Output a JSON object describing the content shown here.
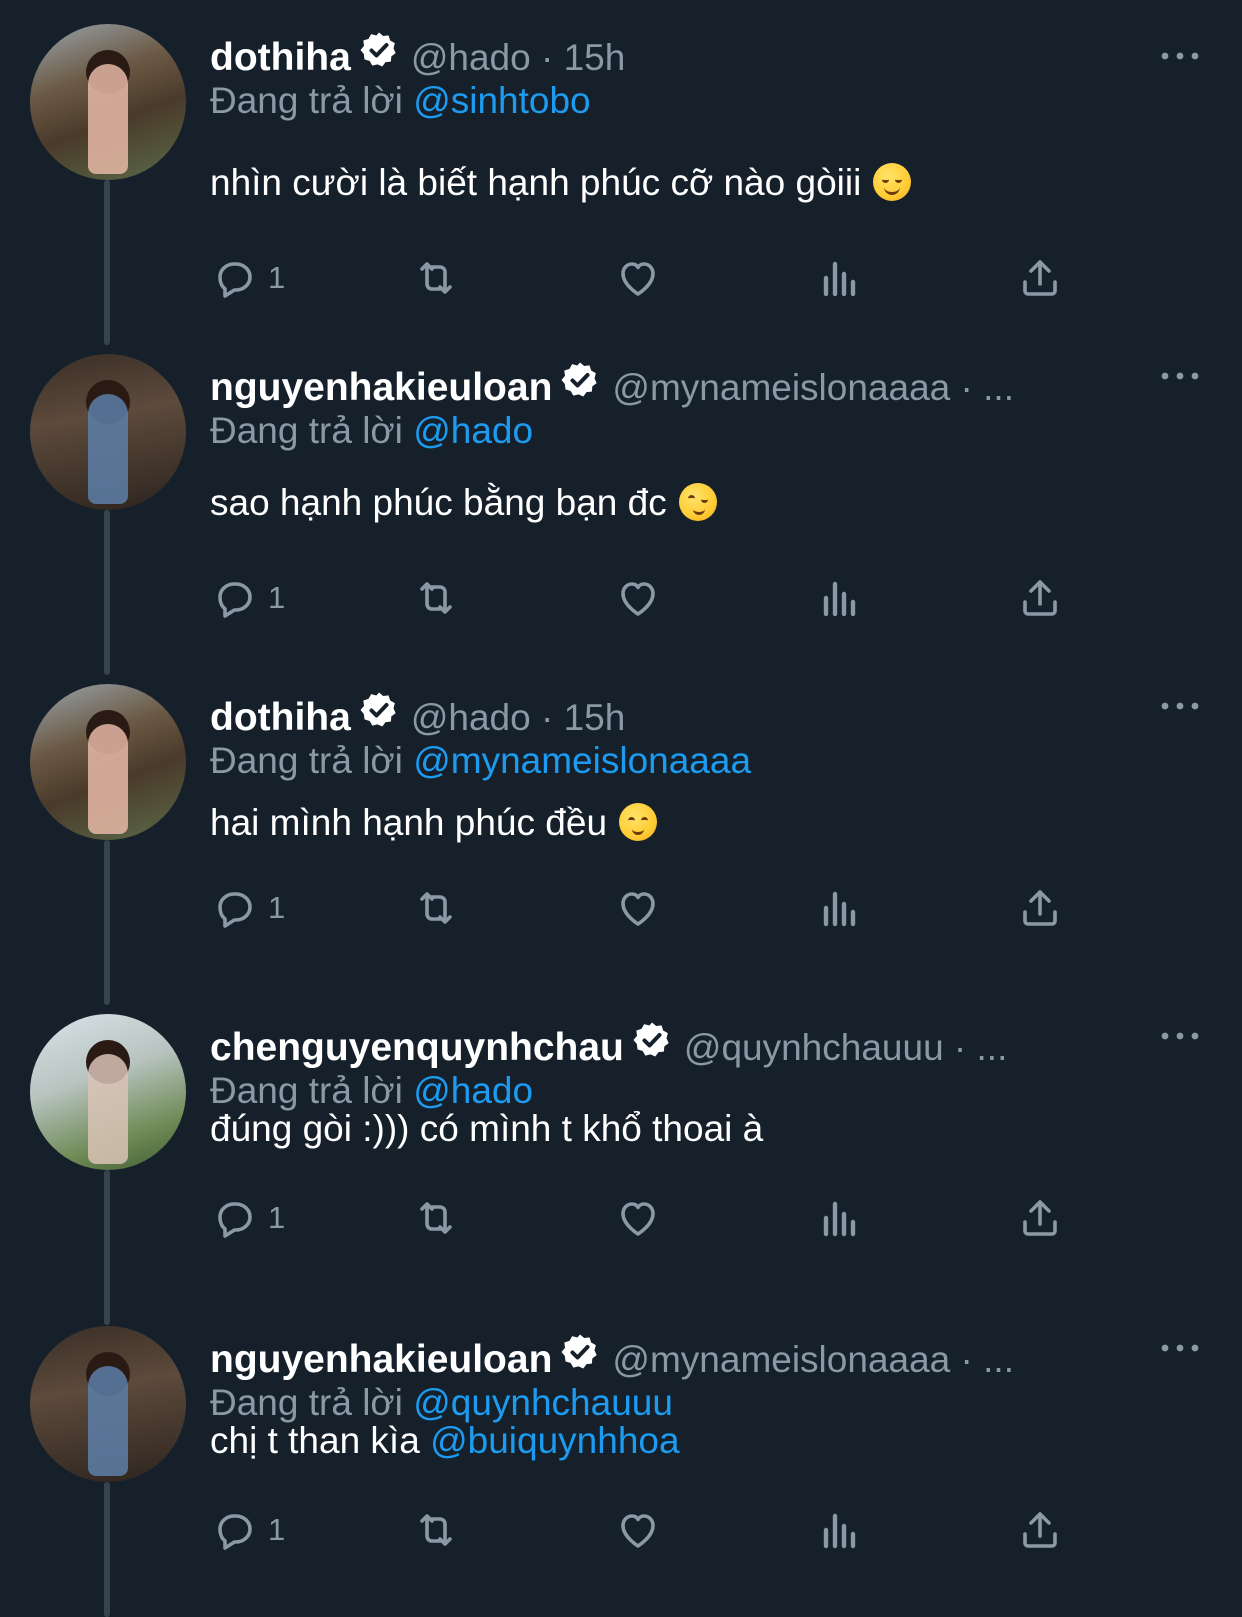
{
  "colors": {
    "background": "#15202b",
    "accent": "#1d9bf0",
    "muted": "#8b98a5",
    "thread_line": "#38444d"
  },
  "reply_prefix": "Đang trả lời",
  "tweets": [
    {
      "name": "dothiha",
      "handle": "@hado · 15h",
      "replying_to": "@sinhtobo",
      "text": "nhìn cười là biết hạnh phúc cỡ nào gòiii",
      "emoji": "grinning-squinting-face",
      "reply_count": "1"
    },
    {
      "name": "nguyenhakieuloan",
      "handle": "@mynameislonaaaa · ...",
      "replying_to": "@hado",
      "text": "sao hạnh phúc bằng bạn đc",
      "emoji": "winking-face",
      "reply_count": "1"
    },
    {
      "name": "dothiha",
      "handle": "@hado · 15h",
      "replying_to": "@mynameislonaaaa",
      "text": "hai mình hạnh phúc đều",
      "emoji": "relieved-face",
      "reply_count": "1"
    },
    {
      "name": "chenguyenquynhchau",
      "handle": "@quynhchauuu · ...",
      "replying_to": "@hado",
      "text": "đúng gòi :))) có mình t khổ thoai à",
      "reply_count": "1"
    },
    {
      "name": "nguyenhakieuloan",
      "handle": "@mynameislonaaaa · ...",
      "replying_to": "@quynhchauuu",
      "text": "chị t than kìa",
      "text_mention": "@buiquynhhoa",
      "reply_count": "1"
    }
  ],
  "icons": {
    "reply": "speech-bubble-icon",
    "retweet": "retweet-icon",
    "like": "heart-icon",
    "views": "bar-chart-icon",
    "share": "share-upload-icon",
    "more": "more-dots-icon",
    "verified": "verified-badge-icon"
  }
}
